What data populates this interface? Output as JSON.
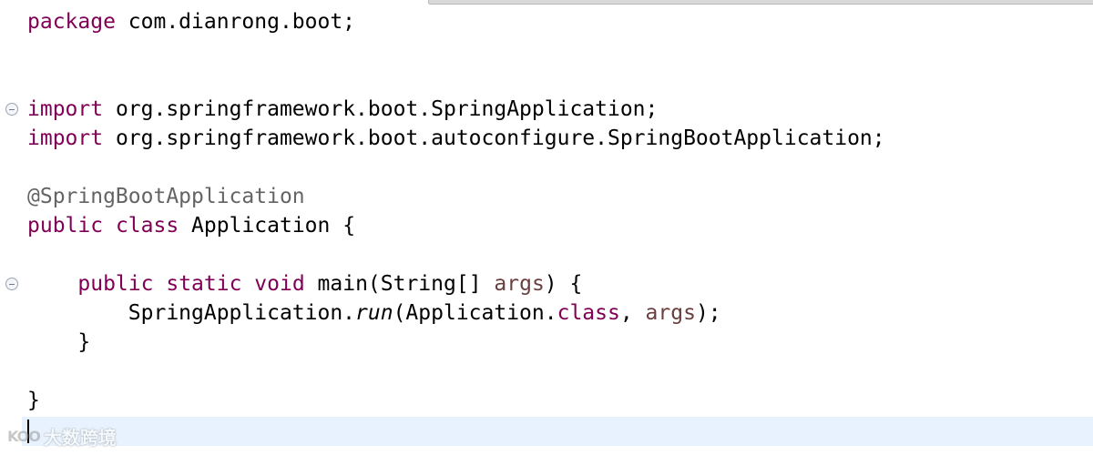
{
  "editor": {
    "lines": [
      {
        "segments": [
          {
            "text": "package",
            "style": "kw"
          },
          {
            "text": " com.dianrong.boot;",
            "style": "plain"
          }
        ]
      },
      {
        "segments": []
      },
      {
        "segments": []
      },
      {
        "segments": [
          {
            "text": "import",
            "style": "kw"
          },
          {
            "text": " org.springframework.boot.SpringApplication;",
            "style": "plain"
          }
        ]
      },
      {
        "segments": [
          {
            "text": "import",
            "style": "kw"
          },
          {
            "text": " org.springframework.boot.autoconfigure.SpringBootApplication;",
            "style": "plain"
          }
        ]
      },
      {
        "segments": []
      },
      {
        "segments": [
          {
            "text": "@SpringBootApplication",
            "style": "ann"
          }
        ]
      },
      {
        "segments": [
          {
            "text": "public",
            "style": "kw"
          },
          {
            "text": " ",
            "style": "plain"
          },
          {
            "text": "class",
            "style": "kw"
          },
          {
            "text": " Application {",
            "style": "plain"
          }
        ]
      },
      {
        "segments": []
      },
      {
        "segments": [
          {
            "text": "    ",
            "style": "plain"
          },
          {
            "text": "public",
            "style": "kw"
          },
          {
            "text": " ",
            "style": "plain"
          },
          {
            "text": "static",
            "style": "kw"
          },
          {
            "text": " ",
            "style": "plain"
          },
          {
            "text": "void",
            "style": "kw"
          },
          {
            "text": " main(String[] ",
            "style": "plain"
          },
          {
            "text": "args",
            "style": "param"
          },
          {
            "text": ") {",
            "style": "plain"
          }
        ]
      },
      {
        "segments": [
          {
            "text": "        SpringApplication.",
            "style": "plain"
          },
          {
            "text": "run",
            "style": "italic"
          },
          {
            "text": "(Application.",
            "style": "plain"
          },
          {
            "text": "class",
            "style": "kw"
          },
          {
            "text": ", ",
            "style": "plain"
          },
          {
            "text": "args",
            "style": "param"
          },
          {
            "text": ");",
            "style": "plain"
          }
        ]
      },
      {
        "segments": [
          {
            "text": "    }",
            "style": "plain"
          }
        ]
      },
      {
        "segments": []
      },
      {
        "segments": [
          {
            "text": "}",
            "style": "plain"
          }
        ]
      },
      {
        "segments": []
      }
    ],
    "fold_markers": [
      {
        "line": 3,
        "icon": "fold-collapse-icon"
      },
      {
        "line": 9,
        "icon": "fold-collapse-icon"
      }
    ],
    "current_line": 14
  },
  "colors": {
    "keyword": "#7f0055",
    "annotation": "#646464",
    "parameter": "#6a3e3e",
    "current_line_highlight": "#e8f2fe"
  },
  "watermark": {
    "logo": "KOO",
    "text": "大数跨境"
  }
}
